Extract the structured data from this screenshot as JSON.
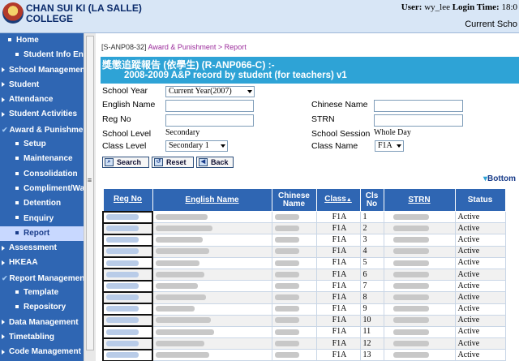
{
  "header": {
    "school_line1": "CHAN SUI KI (LA SALLE)",
    "school_line2": "COLLEGE",
    "user_label": "User:",
    "user_value": "wy_lee",
    "login_label": "Login Time:",
    "login_value": "18:0",
    "current_school": "Current Scho"
  },
  "sidebar": {
    "items": [
      {
        "label": "Home",
        "level": 1,
        "marker": "bullet"
      },
      {
        "label": "Student Info Enq",
        "level": 2,
        "marker": "bullet"
      },
      {
        "label": "School Managemen",
        "level": 0,
        "marker": "arrow"
      },
      {
        "label": "Student",
        "level": 0,
        "marker": "arrow"
      },
      {
        "label": "Attendance",
        "level": 0,
        "marker": "arrow"
      },
      {
        "label": "Student Activities",
        "level": 0,
        "marker": "arrow"
      },
      {
        "label": "Award & Punishme",
        "level": 0,
        "marker": "check"
      },
      {
        "label": "Setup",
        "level": 2,
        "marker": "bullet"
      },
      {
        "label": "Maintenance",
        "level": 2,
        "marker": "bullet"
      },
      {
        "label": "Consolidation",
        "level": 2,
        "marker": "bullet"
      },
      {
        "label": "Compliment/Wa",
        "level": 2,
        "marker": "bullet"
      },
      {
        "label": "Detention",
        "level": 2,
        "marker": "bullet"
      },
      {
        "label": "Enquiry",
        "level": 2,
        "marker": "bullet"
      },
      {
        "label": "Report",
        "level": 2,
        "marker": "bullet",
        "active": true
      },
      {
        "label": "Assessment",
        "level": 0,
        "marker": "arrow"
      },
      {
        "label": "HKEAA",
        "level": 0,
        "marker": "arrow"
      },
      {
        "label": "Report Managemen",
        "level": 0,
        "marker": "check"
      },
      {
        "label": "Template",
        "level": 2,
        "marker": "bullet"
      },
      {
        "label": "Repository",
        "level": 2,
        "marker": "bullet"
      },
      {
        "label": "Data Management",
        "level": 0,
        "marker": "arrow"
      },
      {
        "label": "Timetabling",
        "level": 0,
        "marker": "arrow"
      },
      {
        "label": "Code Management",
        "level": 0,
        "marker": "arrow"
      }
    ]
  },
  "breadcrumb": {
    "code": "[S-ANP08-32]",
    "path": "Award & Punishment > Report"
  },
  "report": {
    "title_cn": "獎懲追蹤報告 (依學生) (R-ANP066-C) :-",
    "title_en": "2008-2009 A&P record by student (for teachers) v1"
  },
  "form": {
    "school_year_label": "School Year",
    "school_year_value": "Current Year(2007)",
    "english_name_label": "English Name",
    "chinese_name_label": "Chinese Name",
    "reg_no_label": "Reg No",
    "strn_label": "STRN",
    "school_level_label": "School Level",
    "school_level_value": "Secondary",
    "school_session_label": "School Session",
    "school_session_value": "Whole Day",
    "class_level_label": "Class Level",
    "class_level_value": "Secondary 1",
    "class_name_label": "Class Name",
    "class_name_value": "F1A"
  },
  "buttons": {
    "search": "Search",
    "reset": "Reset",
    "back": "Back"
  },
  "bottom_link": "Bottom",
  "table": {
    "headers": {
      "reg_no": "Reg No",
      "english_name": "English Name",
      "chinese_name": "Chinese Name",
      "class": "Class",
      "cls_no": "Cls No",
      "strn": "STRN",
      "status": "Status"
    },
    "rows": [
      {
        "class": "F1A",
        "no": "1",
        "status": "Active"
      },
      {
        "class": "F1A",
        "no": "2",
        "status": "Active"
      },
      {
        "class": "F1A",
        "no": "3",
        "status": "Active"
      },
      {
        "class": "F1A",
        "no": "4",
        "status": "Active"
      },
      {
        "class": "F1A",
        "no": "5",
        "status": "Active"
      },
      {
        "class": "F1A",
        "no": "6",
        "status": "Active"
      },
      {
        "class": "F1A",
        "no": "7",
        "status": "Active"
      },
      {
        "class": "F1A",
        "no": "8",
        "status": "Active"
      },
      {
        "class": "F1A",
        "no": "9",
        "status": "Active"
      },
      {
        "class": "F1A",
        "no": "10",
        "status": "Active"
      },
      {
        "class": "F1A",
        "no": "11",
        "status": "Active"
      },
      {
        "class": "F1A",
        "no": "12",
        "status": "Active"
      },
      {
        "class": "F1A",
        "no": "13",
        "status": "Active"
      }
    ]
  }
}
